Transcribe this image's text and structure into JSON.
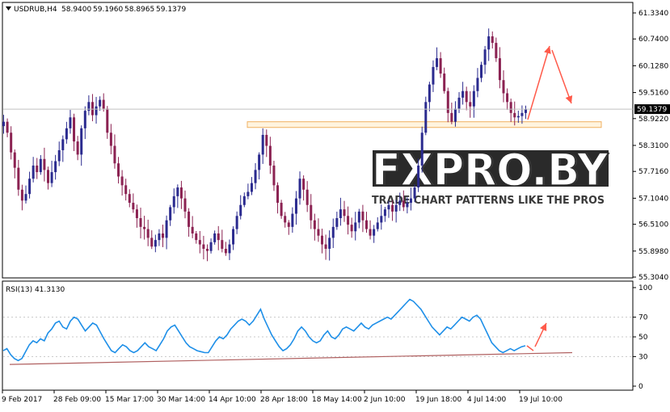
{
  "chart_data": [
    {
      "type": "candlestick",
      "symbol_line": {
        "symbol": "USDRUB,H4",
        "open": "58.9400",
        "high": "59.1960",
        "low": "58.8965",
        "close": "59.1379"
      },
      "y_ticks": [
        "61.3340",
        "60.7400",
        "60.1280",
        "59.5160",
        "58.9220",
        "58.3100",
        "57.7160",
        "57.1040",
        "56.5100",
        "55.8980",
        "55.3040"
      ],
      "y_tick_values": [
        61.334,
        60.74,
        60.128,
        59.516,
        58.922,
        58.31,
        57.716,
        57.104,
        56.51,
        55.898,
        55.304
      ],
      "ylim": [
        55.304,
        61.334
      ],
      "current_price_label": "59.1379",
      "current_price": 59.1379,
      "resistance_zone": [
        58.72,
        58.85
      ],
      "series": [
        {
          "values": [
            58.85,
            58.6,
            58.15,
            57.8,
            57.3,
            57.05,
            57.2,
            57.55,
            57.85,
            57.7,
            58.0,
            57.75,
            57.45,
            57.7,
            57.95,
            58.2,
            58.45,
            58.7,
            58.95,
            58.4,
            58.1,
            58.7,
            59.1,
            59.3,
            59.0,
            59.2,
            59.35,
            59.15,
            58.6,
            58.3,
            57.9,
            57.6,
            57.4,
            57.2,
            57.0,
            56.85,
            56.65,
            56.45,
            56.4,
            56.2,
            56.0,
            56.15,
            56.3,
            56.2,
            56.6,
            56.9,
            57.15,
            57.35,
            57.1,
            56.8,
            56.45,
            56.3,
            56.15,
            56.05,
            55.95,
            55.9,
            56.1,
            56.3,
            56.15,
            55.95,
            55.85,
            56.05,
            56.4,
            56.7,
            56.95,
            57.15,
            57.25,
            57.45,
            57.75,
            58.1,
            58.55,
            58.3,
            57.85,
            57.4,
            57.0,
            56.7,
            56.55,
            56.45,
            56.75,
            57.1,
            57.55,
            57.3,
            56.95,
            56.6,
            56.4,
            56.25,
            56.05,
            55.95,
            56.2,
            56.45,
            56.65,
            56.85,
            56.7,
            56.5,
            56.35,
            56.55,
            56.8,
            56.6,
            56.4,
            56.25,
            56.4,
            56.55,
            56.7,
            56.85,
            56.95,
            56.8,
            56.95,
            57.05,
            56.9,
            57.0,
            57.1,
            57.35,
            57.85,
            58.6,
            59.3,
            59.7,
            60.1,
            60.3,
            59.95,
            59.55,
            59.05,
            58.85,
            59.15,
            59.4,
            59.55,
            59.3,
            59.2,
            59.55,
            59.85,
            60.15,
            60.5,
            60.8,
            60.65,
            60.3,
            59.8,
            59.5,
            59.3,
            59.05,
            58.95,
            58.98,
            59.05,
            59.14
          ]
        }
      ],
      "annotations": [
        "projection up",
        "projection down"
      ]
    },
    {
      "type": "line",
      "title": "RSI(13) 41.3130",
      "y_ticks": [
        "100",
        "70",
        "50",
        "30",
        "0"
      ],
      "y_tick_values": [
        100,
        70,
        50,
        30,
        0
      ],
      "ylim": [
        0,
        100
      ],
      "series": [
        {
          "values": [
            36,
            38,
            32,
            28,
            26,
            28,
            35,
            42,
            46,
            44,
            48,
            46,
            54,
            58,
            64,
            66,
            60,
            58,
            66,
            70,
            68,
            62,
            56,
            60,
            64,
            62,
            55,
            48,
            42,
            36,
            34,
            38,
            42,
            40,
            36,
            34,
            36,
            40,
            44,
            40,
            38,
            36,
            42,
            48,
            56,
            60,
            62,
            56,
            50,
            44,
            40,
            38,
            36,
            35,
            34,
            34,
            40,
            46,
            50,
            48,
            52,
            58,
            62,
            66,
            68,
            66,
            62,
            66,
            72,
            78,
            68,
            60,
            52,
            46,
            40,
            36,
            38,
            42,
            48,
            56,
            60,
            56,
            50,
            46,
            44,
            46,
            52,
            56,
            50,
            48,
            52,
            58,
            60,
            58,
            56,
            60,
            64,
            60,
            58,
            62,
            64,
            66,
            68,
            70,
            68,
            72,
            76,
            80,
            84,
            88,
            86,
            82,
            78,
            72,
            66,
            60,
            56,
            52,
            56,
            60,
            58,
            62,
            66,
            70,
            68,
            66,
            70,
            72,
            68,
            60,
            52,
            44,
            40,
            36,
            34,
            36,
            38,
            36,
            38,
            40,
            41
          ]
        }
      ],
      "trendline": [
        22,
        34
      ],
      "annotations": [
        "projection up"
      ]
    }
  ],
  "x_axis": {
    "labels": [
      "9 Feb 2017",
      "28 Feb 09:00",
      "15 Mar 17:00",
      "30 Mar 14:00",
      "14 Apr 10:00",
      "28 Apr 18:00",
      "18 May 14:00",
      "2 Jun 10:00",
      "19 Jun 18:00",
      "4 Jul 14:00",
      "19 Jul 10:00"
    ]
  },
  "watermark": {
    "text": "FXPRO.BY",
    "tagline": "TRADE CHART PATTERNS LIKE THE PROS"
  },
  "colors": {
    "bull_candle": "#2b2b8f",
    "bear_candle": "#8b2252",
    "rsi_line": "#1e8fe8",
    "trendline": "#b06060",
    "arrows": "#ff5a4a",
    "zone_border": "#f0b060",
    "zone_fill": "#fff4df"
  }
}
